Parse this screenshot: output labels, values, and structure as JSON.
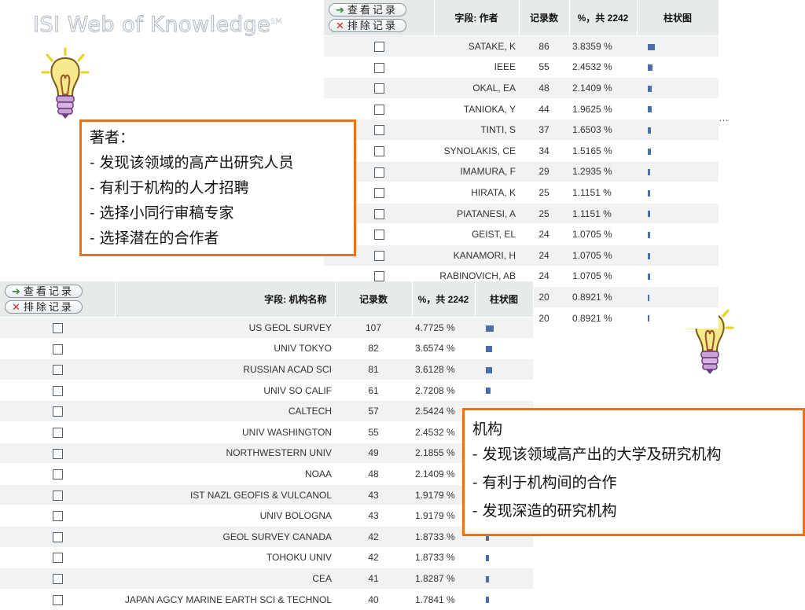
{
  "logo": {
    "text": "ISI Web of Knowledge",
    "mark": "SM"
  },
  "ellipsis": "…",
  "buttons": {
    "view": "查看记录",
    "exclude": "排除记录",
    "view_icon": "arrow-right-icon",
    "exclude_icon": "x-icon"
  },
  "authors_table": {
    "headers": {
      "field": "字段: 作者",
      "count": "记录数",
      "pct": "%，共 2242",
      "chart": "柱状图"
    },
    "rows": [
      {
        "name": "SATAKE, K",
        "count": "86",
        "pct": "3.8359 %",
        "share": 3.8359
      },
      {
        "name": "IEEE",
        "count": "55",
        "pct": "2.4532 %",
        "share": 2.4532
      },
      {
        "name": "OKAL, EA",
        "count": "48",
        "pct": "2.1409 %",
        "share": 2.1409
      },
      {
        "name": "TANIOKA, Y",
        "count": "44",
        "pct": "1.9625 %",
        "share": 1.9625
      },
      {
        "name": "TINTI, S",
        "count": "37",
        "pct": "1.6503 %",
        "share": 1.6503
      },
      {
        "name": "SYNOLAKIS, CE",
        "count": "34",
        "pct": "1.5165 %",
        "share": 1.5165
      },
      {
        "name": "IMAMURA, F",
        "count": "29",
        "pct": "1.2935 %",
        "share": 1.2935
      },
      {
        "name": "HIRATA, K",
        "count": "25",
        "pct": "1.1151 %",
        "share": 1.1151
      },
      {
        "name": "PIATANESI, A",
        "count": "25",
        "pct": "1.1151 %",
        "share": 1.1151
      },
      {
        "name": "GEIST, EL",
        "count": "24",
        "pct": "1.0705 %",
        "share": 1.0705
      },
      {
        "name": "KANAMORI, H",
        "count": "24",
        "pct": "1.0705 %",
        "share": 1.0705
      },
      {
        "name": "RABINOVICH, AB",
        "count": "24",
        "pct": "1.0705 %",
        "share": 1.0705
      },
      {
        "name": "",
        "count": "20",
        "pct": "0.8921 %",
        "share": 0.8921
      },
      {
        "name": "",
        "count": "20",
        "pct": "0.8921 %",
        "share": 0.8921
      }
    ]
  },
  "institutions_table": {
    "headers": {
      "field": "字段: 机构名称",
      "count": "记录数",
      "pct": "%，共 2242",
      "chart": "柱状图"
    },
    "rows": [
      {
        "name": "US GEOL SURVEY",
        "count": "107",
        "pct": "4.7725 %",
        "share": 4.7725
      },
      {
        "name": "UNIV TOKYO",
        "count": "82",
        "pct": "3.6574 %",
        "share": 3.6574
      },
      {
        "name": "RUSSIAN ACAD SCI",
        "count": "81",
        "pct": "3.6128 %",
        "share": 3.6128
      },
      {
        "name": "UNIV SO CALIF",
        "count": "61",
        "pct": "2.7208 %",
        "share": 2.7208
      },
      {
        "name": "CALTECH",
        "count": "57",
        "pct": "2.5424 %",
        "share": 2.5424
      },
      {
        "name": "UNIV WASHINGTON",
        "count": "55",
        "pct": "2.4532 %",
        "share": 2.4532
      },
      {
        "name": "NORTHWESTERN UNIV",
        "count": "49",
        "pct": "2.1855 %",
        "share": 2.1855
      },
      {
        "name": "NOAA",
        "count": "48",
        "pct": "2.1409 %",
        "share": 2.1409
      },
      {
        "name": "IST NAZL GEOFIS & VULCANOL",
        "count": "43",
        "pct": "1.9179 %",
        "share": 1.9179
      },
      {
        "name": "UNIV BOLOGNA",
        "count": "43",
        "pct": "1.9179 %",
        "share": 1.9179
      },
      {
        "name": "GEOL SURVEY CANADA",
        "count": "42",
        "pct": "1.8733 %",
        "share": 1.8733
      },
      {
        "name": "TOHOKU UNIV",
        "count": "42",
        "pct": "1.8733 %",
        "share": 1.8733
      },
      {
        "name": "CEA",
        "count": "41",
        "pct": "1.8287 %",
        "share": 1.8287
      },
      {
        "name": "JAPAN AGCY MARINE EARTH SCI & TECHNOL",
        "count": "40",
        "pct": "1.7841 %",
        "share": 1.7841
      }
    ]
  },
  "author_note": {
    "title": "著者：",
    "lines": [
      "- 发现该领域的高产出研究人员",
      "- 有利于机构的人才招聘",
      "- 选择小同行审稿专家",
      "- 选择潜在的合作者"
    ]
  },
  "institution_note": {
    "title": "机构",
    "lines": [
      "- 发现该领域高产出的大学及研究机构",
      "- 有利于机构间的合作",
      "- 发现深造的研究机构"
    ]
  },
  "colors": {
    "accent_border": "#e8731f",
    "bar": "#4a6ea8",
    "header_bg": "#e6ebe9",
    "row_alt": "#f1f2f3"
  },
  "icons": {
    "bulb": "lightbulb-icon"
  }
}
